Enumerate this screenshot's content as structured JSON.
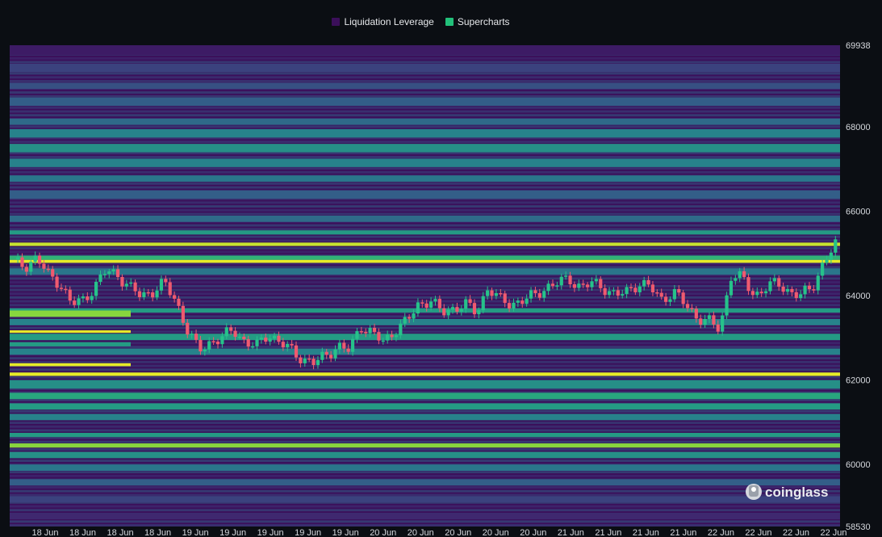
{
  "chart_data": {
    "type": "heatmap",
    "legend": [
      {
        "label": "Liquidation Leverage",
        "color": "#3b0f5a"
      },
      {
        "label": "Supercharts",
        "color": "#22c07a"
      }
    ],
    "ylim": [
      58530,
      69938
    ],
    "y_tick_labels": [
      "69938",
      "68000",
      "66000",
      "64000",
      "62000",
      "60000",
      "58530"
    ],
    "y_tick_values": [
      69938,
      68000,
      66000,
      64000,
      62000,
      60000,
      58530
    ],
    "x_tick_labels": [
      "18 Jun",
      "18 Jun",
      "18 Jun",
      "18 Jun",
      "19 Jun",
      "19 Jun",
      "19 Jun",
      "19 Jun",
      "19 Jun",
      "20 Jun",
      "20 Jun",
      "20 Jun",
      "20 Jun",
      "20 Jun",
      "21 Jun",
      "21 Jun",
      "21 Jun",
      "21 Jun",
      "22 Jun",
      "22 Jun",
      "22 Jun",
      "22 Jun"
    ],
    "heatmap_bands": [
      {
        "from": 69700,
        "to": 69938,
        "level": 0.05
      },
      {
        "from": 69300,
        "to": 69500,
        "level": 0.2
      },
      {
        "from": 68900,
        "to": 69050,
        "level": 0.25
      },
      {
        "from": 68500,
        "to": 68700,
        "level": 0.3
      },
      {
        "from": 68050,
        "to": 68200,
        "level": 0.35
      },
      {
        "from": 67750,
        "to": 67950,
        "level": 0.45
      },
      {
        "from": 67400,
        "to": 67600,
        "level": 0.5
      },
      {
        "from": 67050,
        "to": 67250,
        "level": 0.45
      },
      {
        "from": 66700,
        "to": 66850,
        "level": 0.4
      },
      {
        "from": 66300,
        "to": 66500,
        "level": 0.3
      },
      {
        "from": 65750,
        "to": 65900,
        "level": 0.35
      },
      {
        "from": 65450,
        "to": 65550,
        "level": 0.55
      },
      {
        "from": 65180,
        "to": 65260,
        "level": 0.95
      },
      {
        "from": 64850,
        "to": 64950,
        "level": 0.65
      },
      {
        "from": 64780,
        "to": 64850,
        "level": 1.0
      },
      {
        "from": 64500,
        "to": 64650,
        "level": 0.4
      },
      {
        "from": 63600,
        "to": 63700,
        "level": 0.55
      },
      {
        "from": 63300,
        "to": 63450,
        "level": 0.45
      },
      {
        "from": 62950,
        "to": 63100,
        "level": 0.55
      },
      {
        "from": 62600,
        "to": 62750,
        "level": 0.45
      },
      {
        "from": 62100,
        "to": 62180,
        "level": 1.0
      },
      {
        "from": 61800,
        "to": 62000,
        "level": 0.5
      },
      {
        "from": 61550,
        "to": 61700,
        "level": 0.6
      },
      {
        "from": 61300,
        "to": 61450,
        "level": 0.55
      },
      {
        "from": 61050,
        "to": 61200,
        "level": 0.45
      },
      {
        "from": 60650,
        "to": 60750,
        "level": 0.55
      },
      {
        "from": 60400,
        "to": 60500,
        "level": 0.85
      },
      {
        "from": 60150,
        "to": 60300,
        "level": 0.5
      },
      {
        "from": 59850,
        "to": 60000,
        "level": 0.4
      },
      {
        "from": 59500,
        "to": 59650,
        "level": 0.3
      },
      {
        "from": 59100,
        "to": 59250,
        "level": 0.2
      },
      {
        "from": 58700,
        "to": 58850,
        "level": 0.1
      }
    ],
    "early_bands": [
      {
        "from": 63500,
        "to": 63650,
        "level": 0.85
      },
      {
        "from": 63120,
        "to": 63180,
        "level": 1.0
      },
      {
        "from": 62800,
        "to": 62900,
        "level": 0.55
      },
      {
        "from": 62330,
        "to": 62400,
        "level": 1.0
      }
    ],
    "price_path": [
      64800,
      64700,
      64900,
      64500,
      64300,
      63800,
      63900,
      64200,
      64600,
      64500,
      64200,
      64000,
      64100,
      64300,
      63900,
      63200,
      62700,
      62900,
      63000,
      63200,
      62900,
      62800,
      63100,
      62900,
      62700,
      62500,
      62400,
      62600,
      62800,
      62700,
      63300,
      63100,
      62900,
      63200,
      63400,
      63800,
      63900,
      63600,
      63700,
      63800,
      63600,
      64200,
      63900,
      63800,
      63900,
      64000,
      64200,
      64300,
      64400,
      64200,
      64300,
      64200,
      64000,
      64100,
      64300,
      64200,
      63900,
      64100,
      63800,
      63500,
      63400,
      63200,
      64500,
      64400,
      64000,
      64200,
      64300,
      64100,
      64000,
      64200,
      64800,
      65200
    ]
  },
  "watermark": "coinglass"
}
